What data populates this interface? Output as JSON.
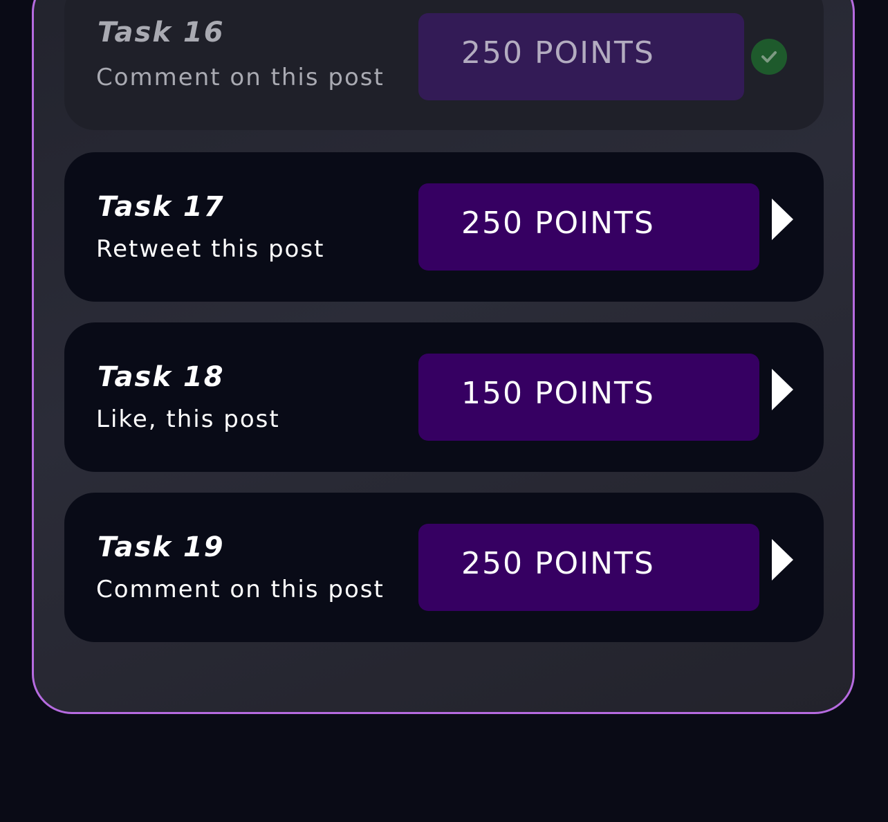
{
  "tasks": [
    {
      "title": "Task 16",
      "description": "Comment on this post",
      "points_label": "250 POINTS",
      "status": "completed"
    },
    {
      "title": "Task 17",
      "description": "Retweet this post",
      "points_label": "250 POINTS",
      "status": "open"
    },
    {
      "title": "Task 18",
      "description": "Like, this post",
      "points_label": "150 POINTS",
      "status": "open"
    },
    {
      "title": "Task 19",
      "description": "Comment on this post",
      "points_label": "250 POINTS",
      "status": "open"
    }
  ],
  "colors": {
    "panel_border": "#b66be0",
    "card_bg": "#090b17",
    "points_bg": "#360062",
    "check_bg": "#1e5a2c"
  }
}
